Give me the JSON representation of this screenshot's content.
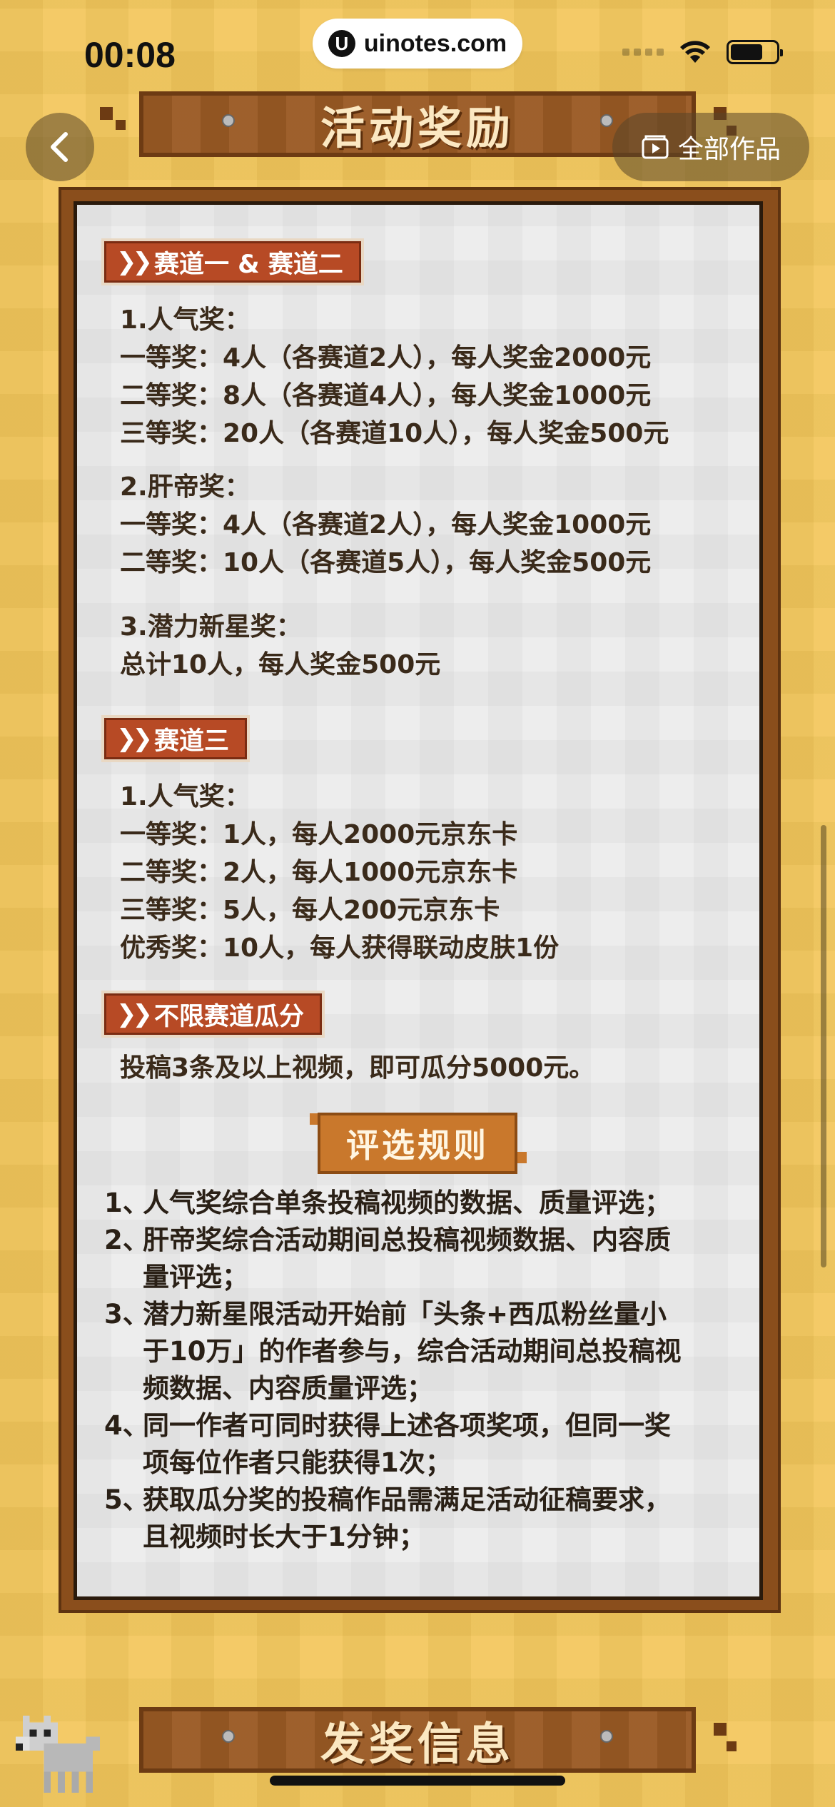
{
  "status_bar": {
    "time": "00:08",
    "url": "uinotes.com",
    "url_logo": "U"
  },
  "header": {
    "title": "活动奖励",
    "works_button": "全部作品",
    "back_icon": "chevron-left-icon",
    "works_icon": "video-folder-icon"
  },
  "track12": {
    "tag": "赛道一 & 赛道二",
    "popular_title": "1.人气奖：",
    "popular": [
      "一等奖：4人（各赛道2人），每人奖金2000元",
      "二等奖：8人（各赛道4人），每人奖金1000元",
      "三等奖：20人（各赛道10人），每人奖金500元"
    ],
    "grind_title": "2.肝帝奖：",
    "grind": [
      "一等奖：4人（各赛道2人），每人奖金1000元",
      "二等奖：10人（各赛道5人），每人奖金500元"
    ],
    "rising_title": "3.潜力新星奖：",
    "rising": "总计10人，每人奖金500元"
  },
  "track3": {
    "tag": "赛道三",
    "popular_title": "1.人气奖：",
    "popular": [
      "一等奖：1人，每人2000元京东卡",
      "二等奖：2人，每人1000元京东卡",
      "三等奖：5人，每人200元京东卡",
      "优秀奖：10人，每人获得联动皮肤1份"
    ]
  },
  "unlimited": {
    "tag": "不限赛道瓜分",
    "text": "投稿3条及以上视频，即可瓜分5000元。"
  },
  "rules": {
    "title": "评选规则",
    "items": [
      {
        "num": "1、",
        "lines": [
          "人气奖综合单条投稿视频的数据、质量评选；"
        ]
      },
      {
        "num": "2、",
        "lines": [
          "肝帝奖综合活动期间总投稿视频数据、内容质",
          "量评选；"
        ]
      },
      {
        "num": "3、",
        "lines": [
          "潜力新星限活动开始前「头条+西瓜粉丝量小",
          "于10万」的作者参与，综合活动期间总投稿视",
          "频数据、内容质量评选；"
        ]
      },
      {
        "num": "4、",
        "lines": [
          "同一作者可同时获得上述各项奖项，但同一奖",
          "项每位作者只能获得1次；"
        ]
      },
      {
        "num": "5、",
        "lines": [
          "获取瓜分奖的投稿作品需满足活动征稿要求，",
          "且视频时长大于1分钟；"
        ]
      }
    ]
  },
  "footer": {
    "title": "发奖信息"
  },
  "colors": {
    "background": "#f2c24c",
    "wood": "#9a5a24",
    "tag": "#b74a25",
    "card": "#ebebeb"
  }
}
